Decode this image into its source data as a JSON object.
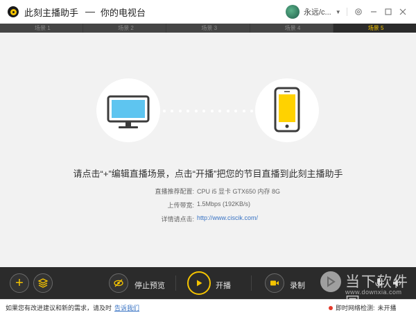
{
  "window": {
    "app_name": "此刻主播助手",
    "tv_name": "你的电视台",
    "user_name": "永远/c...",
    "controls": {
      "settings_icon": "gear-icon",
      "minimize_icon": "minimize-icon",
      "maximize_icon": "maximize-icon",
      "close_icon": "close-icon"
    }
  },
  "tabs": [
    {
      "label": "场景 1",
      "active": false
    },
    {
      "label": "场景 2",
      "active": false
    },
    {
      "label": "场景 3",
      "active": false
    },
    {
      "label": "场景 4",
      "active": false
    },
    {
      "label": "场景 5",
      "active": true
    }
  ],
  "main": {
    "headline": "请点击“+”编辑直播场景，点击“开播”把您的节目直播到此刻主播助手",
    "specs": [
      {
        "label": "直播推荐配置:",
        "value": "CPU i5  显卡 GTX650  内存 8G"
      },
      {
        "label": "上传带宽:",
        "value": "1.5Mbps (192KB/s)"
      },
      {
        "label": "详情请点击:",
        "value": "http://www.ciscik.com/",
        "is_link": true
      }
    ],
    "colors": {
      "screen_blue": "#5ec5f0",
      "phone_yellow": "#ffd200",
      "accent": "#f5c400"
    }
  },
  "controls": {
    "stop_preview_label": "停止预览",
    "start_label": "开播",
    "record_label": "录制"
  },
  "statusbar": {
    "message": "如果您有改进建议和新的需求，请及时",
    "feedback_link": "告诉我们",
    "network_label": "即时网络检测:",
    "network_status": "未开播"
  },
  "watermark": {
    "text": "当下软件园",
    "url": "www.downxia.com"
  }
}
